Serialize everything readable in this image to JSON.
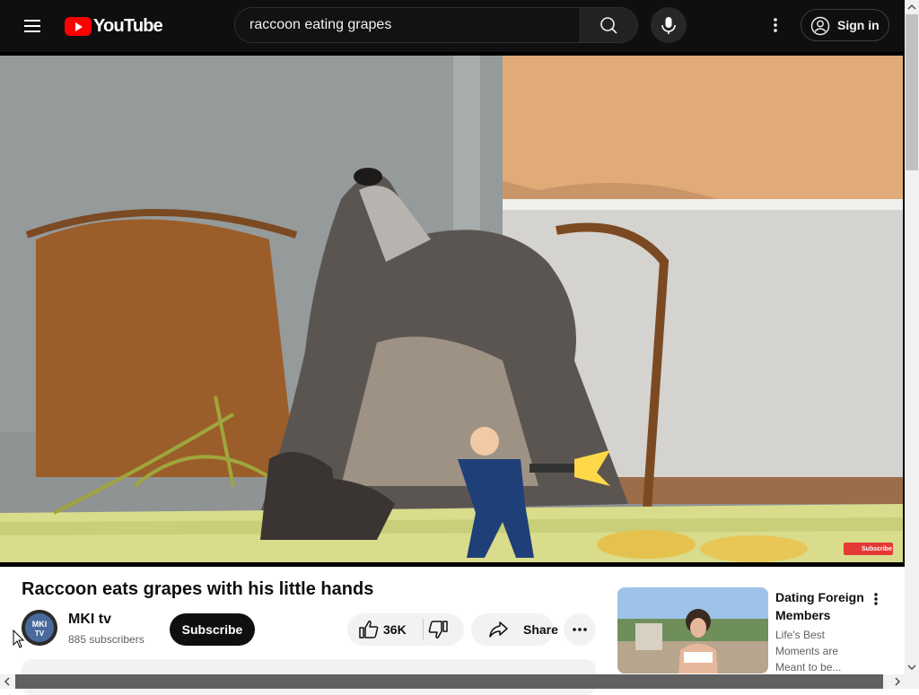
{
  "app": {
    "logo_text": "YouTube"
  },
  "header": {
    "search_value": "raccoon eating grapes",
    "sign_in_label": "Sign in",
    "icons": [
      "menu-icon",
      "search-icon",
      "microphone-icon",
      "more-vert-icon",
      "account-icon"
    ]
  },
  "video": {
    "title": "Raccoon eats grapes with his little hands",
    "watermark_label": "Subscribe"
  },
  "channel": {
    "name": "MKI tv",
    "avatar_text": "MKI TV",
    "subscribers": "885 subscribers",
    "subscribe_label": "Subscribe"
  },
  "actions": {
    "like_count": "36K",
    "share_label": "Share"
  },
  "sidebar_ad": {
    "title": "Dating Foreign Members",
    "description": "Life's Best Moments are Meant to be..."
  },
  "colors": {
    "topbar_bg": "#0f0f0f",
    "logo_red": "#ff0000",
    "button_bg": "#f2f2f2",
    "subscribe_bg": "#0f0f0f"
  }
}
